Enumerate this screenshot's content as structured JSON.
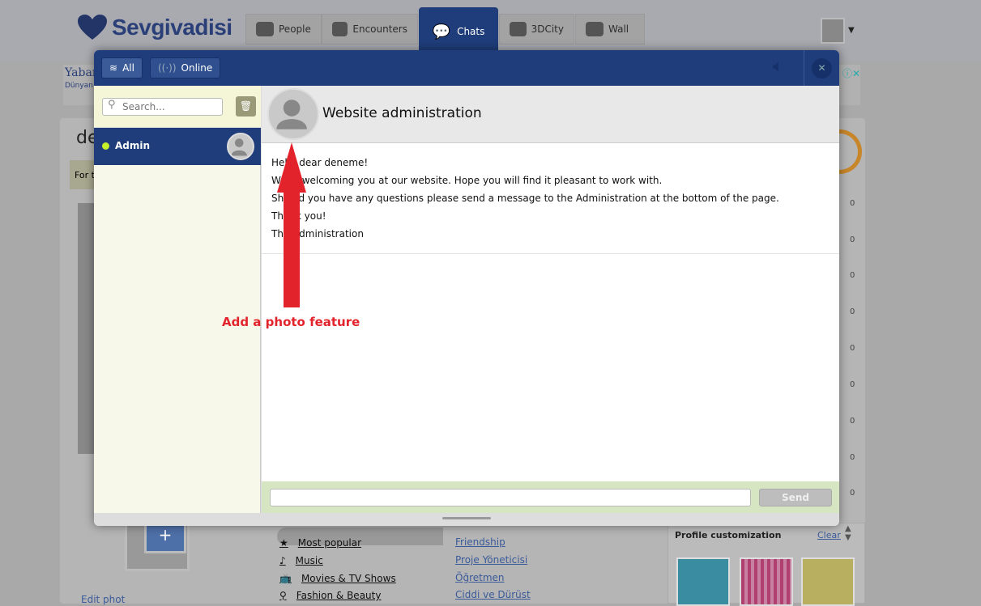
{
  "site": {
    "logo": "Sevgivadisi"
  },
  "nav": [
    {
      "label": "People"
    },
    {
      "label": "Encounters"
    },
    {
      "label": "Chats"
    },
    {
      "label": "3DCity"
    },
    {
      "label": "Wall"
    }
  ],
  "background": {
    "ad_title": "Yaban",
    "ad_sub": "Dünyan",
    "profile_name": "de",
    "notice": "For t",
    "counts": [
      "0",
      "0",
      "0",
      "0",
      "0",
      "0",
      "0",
      "0",
      "0"
    ],
    "categories": [
      {
        "label": "Most popular",
        "icon": "star-icon"
      },
      {
        "label": "Music",
        "icon": "music-note-icon"
      },
      {
        "label": "Movies & TV Shows",
        "icon": "tv-icon"
      },
      {
        "label": "Fashion & Beauty",
        "icon": "hanger-icon"
      }
    ],
    "links": [
      "Friendship",
      "Proje Yöneticisi",
      "Öğretmen",
      "Ciddi ve Dürüst"
    ],
    "customization": {
      "title": "Profile customization",
      "clear": "Clear"
    },
    "edit_photo": "Edit phot"
  },
  "chat": {
    "tabs": [
      {
        "label": "All",
        "icon": "layers-icon"
      },
      {
        "label": "Online",
        "icon": "broadcast-icon"
      }
    ],
    "search_placeholder": "Search...",
    "contacts": [
      {
        "name": "Admin",
        "status": "online",
        "status_color": "#c6f02a"
      }
    ],
    "conversation_title": "Website administration",
    "messages": [
      "Hello dear deneme!",
      "We're welcoming you at our website. Hope you will find it pleasant to work with.",
      "Should you have any questions please send a message to the Administration at the bottom of the page.",
      "Thank you!",
      "The Administration"
    ],
    "send_label": "Send",
    "input_value": ""
  },
  "annotation": {
    "text": "Add a photo feature",
    "color": "#e3232b"
  },
  "colors": {
    "brand": "#1f3d7a"
  }
}
